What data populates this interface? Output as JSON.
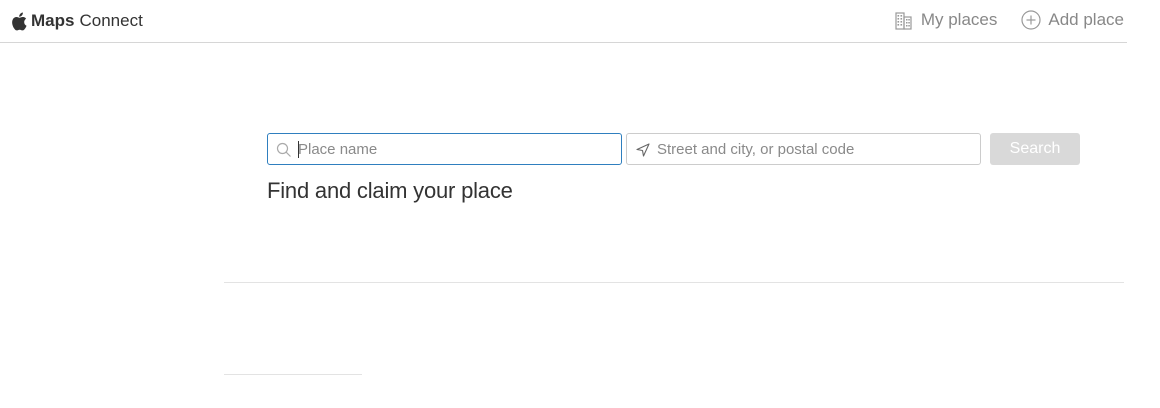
{
  "header": {
    "brand_bold": "Maps",
    "brand_rest": "Connect",
    "nav": {
      "my_places": "My places",
      "add_place": "Add place"
    }
  },
  "search": {
    "place_placeholder": "Place name",
    "address_placeholder": "Street and city, or postal code",
    "button_label": "Search"
  },
  "headline": "Find and claim your place",
  "colors": {
    "focus_border": "#2f7fbf",
    "disabled_button": "#d9d9d9",
    "nav_text": "#888888"
  },
  "icons": {
    "brand": "apple-logo-icon",
    "my_places": "building-icon",
    "add_place": "plus-circle-icon",
    "place_field": "search-icon",
    "address_field": "location-arrow-icon"
  }
}
